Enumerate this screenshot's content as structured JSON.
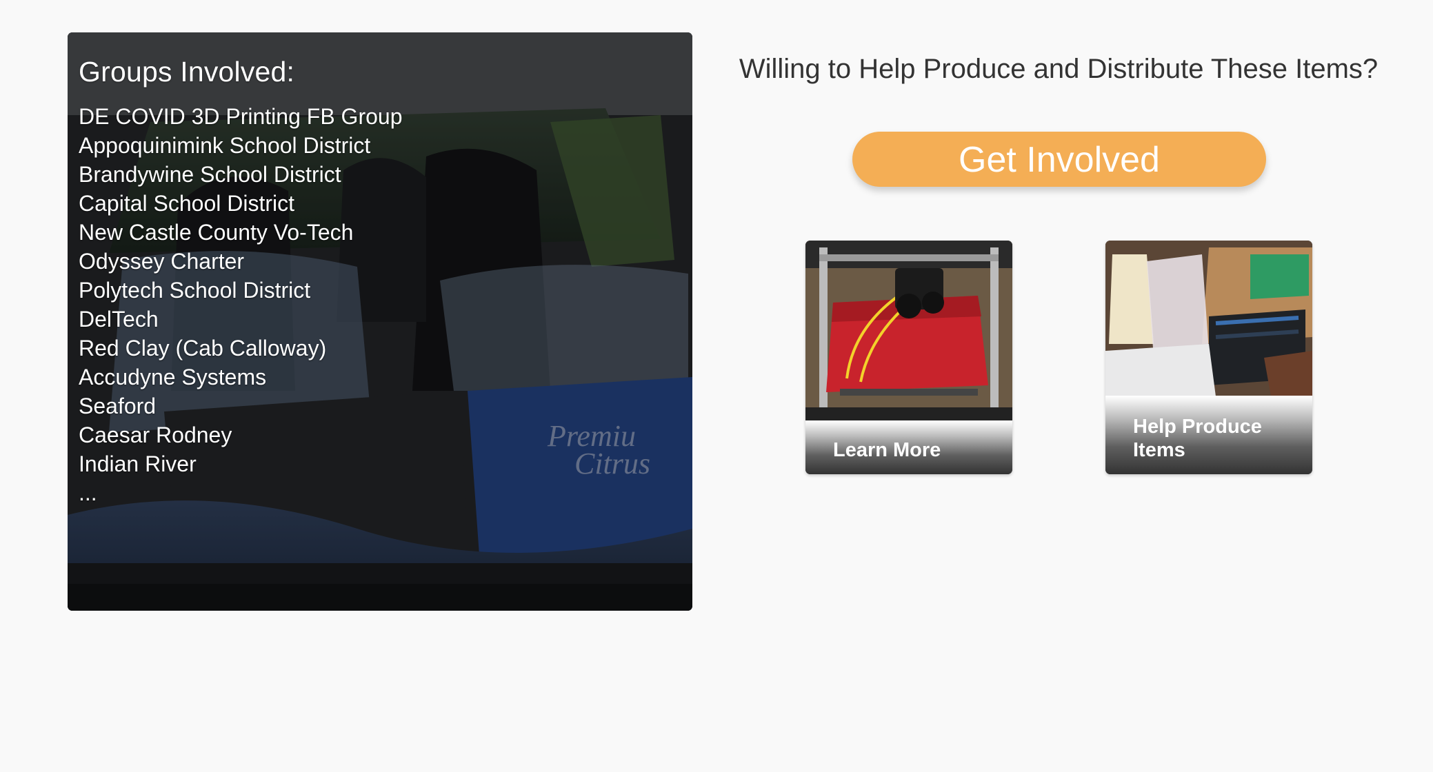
{
  "groups": {
    "title": "Groups Involved:",
    "items": [
      "DE COVID 3D Printing FB Group",
      "Appoquinimink School District",
      "Brandywine School District",
      "Capital School District",
      "New Castle County Vo-Tech",
      "Odyssey Charter",
      "Polytech School District",
      "DelTech",
      "Red Clay (Cab Calloway)",
      "Accudyne Systems",
      "Seaford",
      "Caesar Rodney",
      "Indian River",
      "..."
    ],
    "photo_box_text": [
      "Premiu",
      "Citrus"
    ]
  },
  "cta": {
    "question": "Willing to Help Produce and Distribute These Items?",
    "button_label": "Get Involved",
    "button_color": "#f4ae55"
  },
  "cards": {
    "learn_more": {
      "label": "Learn More",
      "photo": "3d-printer-photo"
    },
    "help_produce": {
      "label": "Help Produce Items",
      "photo": "supplies-box-photo"
    }
  },
  "colors": {
    "background": "#f9f9f9",
    "accent": "#f4ae55",
    "text": "#333333"
  }
}
